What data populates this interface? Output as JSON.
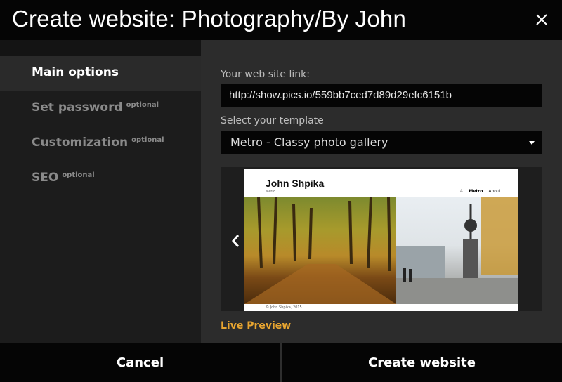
{
  "dialog": {
    "title": "Create website: Photography/By John",
    "close_icon": "close-icon"
  },
  "sidebar": {
    "items": [
      {
        "label": "Main options",
        "optional": "",
        "active": true
      },
      {
        "label": "Set password",
        "optional": "optional",
        "active": false
      },
      {
        "label": "Customization",
        "optional": "optional",
        "active": false
      },
      {
        "label": "SEO",
        "optional": "optional",
        "active": false
      }
    ]
  },
  "main": {
    "link_label": "Your web site link:",
    "link_value": "http://show.pics.io/559bb7ced7d89d29efc6151b",
    "template_label": "Select your template",
    "template_value": "Metro - Classy photo gallery",
    "preview": {
      "site_title": "John Shpika",
      "site_subtitle": "Metro",
      "nav_items": [
        "Metro",
        "About"
      ],
      "footer_text": "© John Shpika, 2015",
      "prev_icon": "chevron-left-icon"
    },
    "live_preview": "Live Preview"
  },
  "footer": {
    "cancel_label": "Cancel",
    "create_label": "Create website"
  },
  "colors": {
    "accent": "#e8a530",
    "background": "#1c1c1c",
    "panel": "#2c2c2c"
  }
}
